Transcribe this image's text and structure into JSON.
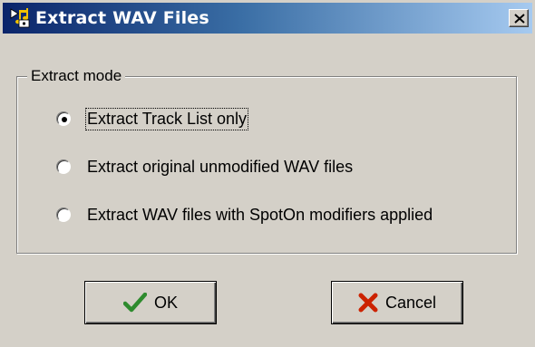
{
  "window": {
    "title": "Extract WAV Files",
    "icon": "music-note-icon"
  },
  "groupbox": {
    "label": "Extract mode"
  },
  "options": [
    {
      "label": "Extract Track List only",
      "selected": true
    },
    {
      "label": "Extract original unmodified WAV files",
      "selected": false
    },
    {
      "label": "Extract WAV files with SpotOn modifiers applied",
      "selected": false
    }
  ],
  "buttons": {
    "ok_label": "OK",
    "cancel_label": "Cancel"
  },
  "colors": {
    "title_start": "#0a246a",
    "title_end": "#a6caf0",
    "face": "#d4d0c8",
    "ok_check": "#2e8b2e",
    "cancel_x": "#cc2200"
  }
}
